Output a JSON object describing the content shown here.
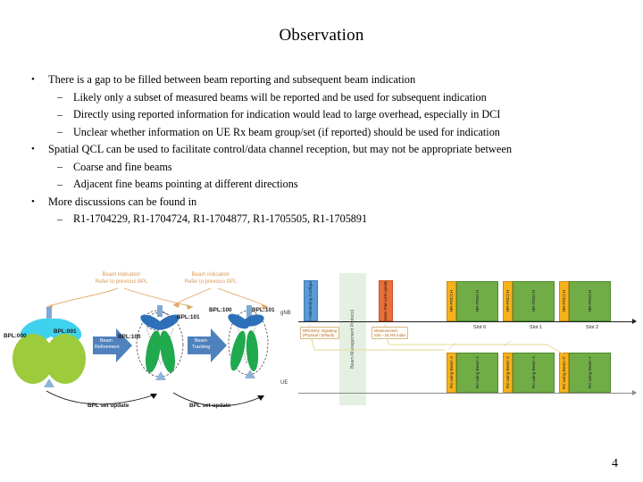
{
  "slide": {
    "title": "Observation",
    "page_number": "4"
  },
  "bullets": [
    {
      "level": 1,
      "marker": "•",
      "text": "There is a gap to be filled between beam reporting and subsequent beam indication"
    },
    {
      "level": 2,
      "marker": "–",
      "text": "Likely only a subset of measured beams will be reported and be used for subsequent indication"
    },
    {
      "level": 2,
      "marker": "–",
      "text": "Directly using reported information for indication would lead to large overhead, especially in DCI"
    },
    {
      "level": 2,
      "marker": "–",
      "text": "Unclear whether information on UE Rx beam group/set (if reported) should be used for indication"
    },
    {
      "level": 1,
      "marker": "•",
      "text": "Spatial QCL can be used to facilitate control/data channel reception, but may not be appropriate between"
    },
    {
      "level": 2,
      "marker": "–",
      "text": "Coarse and fine beams"
    },
    {
      "level": 2,
      "marker": "–",
      "text": "Adjacent fine beams pointing at different directions"
    },
    {
      "level": 1,
      "marker": "•",
      "text": "More discussions can be found in"
    },
    {
      "level": 2,
      "marker": "–",
      "text": "R1-1704229, R1-1704724, R1-1704877, R1-1705505, R1-1705891"
    }
  ],
  "figure_left": {
    "annotations": [
      {
        "line1": "Beam indication",
        "line2": "Refer to previous BPL"
      },
      {
        "line1": "Beam indication",
        "line2": "Refer to previous BPL"
      }
    ],
    "stage_labels": [
      {
        "text": "BPL:000"
      },
      {
        "text": "BPL:001"
      },
      {
        "text": "BPL:101"
      },
      {
        "text": "BPL:100"
      },
      {
        "text": "BPL:100"
      },
      {
        "text": "BPL:101"
      }
    ],
    "process_arrows": [
      {
        "line1": "Beam",
        "line2": "Refinement"
      },
      {
        "line1": "Beam",
        "line2": "Tracking"
      }
    ],
    "bottom_arrows": [
      {
        "text": "BPL set update"
      },
      {
        "text": "BPL set update"
      }
    ],
    "colors": {
      "coarse_lobe": "#9ccb3b",
      "cyan_lobe": "#3fd2ee",
      "blue_beam": "#2e6fba",
      "green_beam": "#21a94e",
      "arrow": "#4f81bd",
      "annotation": "#d99a56"
    }
  },
  "figure_right": {
    "side_labels": {
      "top": "gNB",
      "bottom": "UE"
    },
    "band_label": "Beam Management Protocol",
    "blocks_top": [
      {
        "label": "Beam Monitoring Configuration",
        "color": "blue"
      },
      {
        "label": "Beam Pair-Link Update",
        "color": "orange"
      }
    ],
    "channel_blocks": [
      {
        "label": "NR-PDCCH",
        "color": "yellow"
      },
      {
        "label": "NR-PDSCH",
        "color": "green"
      },
      {
        "label": "NR-PDCCH",
        "color": "yellow"
      },
      {
        "label": "NR-PDSCH",
        "color": "green"
      },
      {
        "label": "NR-PDCCH",
        "color": "yellow"
      },
      {
        "label": "NR-PDSCH",
        "color": "green"
      }
    ],
    "slot_labels": [
      "Slot 0",
      "Slot 1",
      "Slot 2"
    ],
    "ue_blocks": [
      {
        "label": "RX using Beam X",
        "color": "yellow"
      },
      {
        "label": "RX using Beam X",
        "color": "green"
      },
      {
        "label": "RX using Beam X",
        "color": "yellow"
      },
      {
        "label": "RX using Beam X",
        "color": "green"
      },
      {
        "label": "RX using Beam X'",
        "color": "yellow"
      },
      {
        "label": "RX using Beam Y",
        "color": "green"
      }
    ],
    "notes": [
      {
        "line1": "RRC/MAC Signaling",
        "line2": "(Physical / Default)"
      },
      {
        "line1": "Measurement",
        "line2": "Slot – DL RS Index"
      }
    ],
    "colors": {
      "yellow": "#f6b21b",
      "green": "#70ad47",
      "blue": "#5b9bd5",
      "orange": "#e8703a",
      "band": "#dfeedd"
    }
  }
}
